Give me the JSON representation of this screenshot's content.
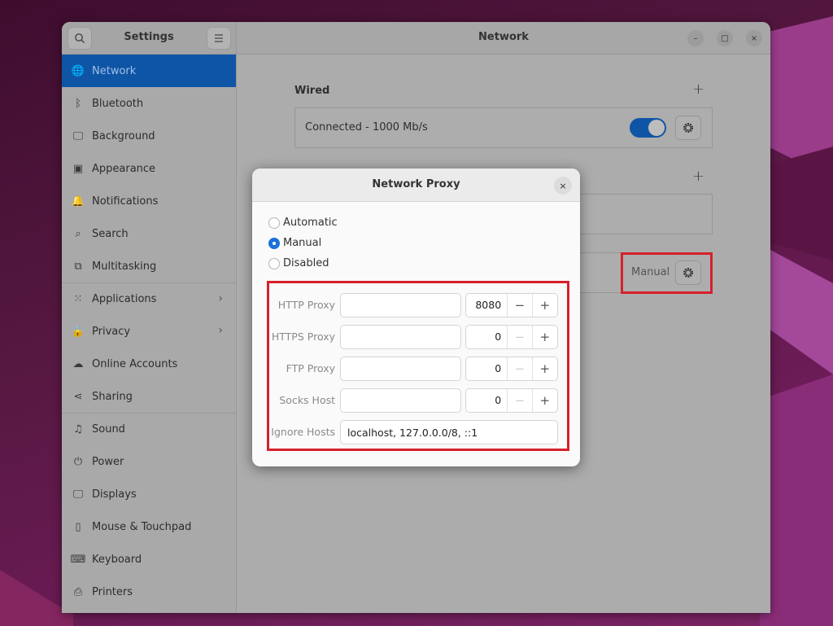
{
  "settings": {
    "title": "Settings",
    "search_icon": "search-icon",
    "menu_icon": "hamburger-menu-icon",
    "sidebar": [
      {
        "label": "Network",
        "icon": "globe-icon",
        "active": true
      },
      {
        "label": "Bluetooth",
        "icon": "bluetooth-icon"
      },
      {
        "label": "Background",
        "icon": "monitor-icon"
      },
      {
        "label": "Appearance",
        "icon": "appearance-icon"
      },
      {
        "label": "Notifications",
        "icon": "bell-icon"
      },
      {
        "label": "Search",
        "icon": "search-icon"
      },
      {
        "label": "Multitasking",
        "icon": "multitasking-icon"
      },
      {
        "label": "Applications",
        "icon": "grid-icon",
        "chevron": true
      },
      {
        "label": "Privacy",
        "icon": "lock-icon",
        "chevron": true
      },
      {
        "label": "Online Accounts",
        "icon": "cloud-icon"
      },
      {
        "label": "Sharing",
        "icon": "share-icon"
      },
      {
        "label": "Sound",
        "icon": "music-note-icon"
      },
      {
        "label": "Power",
        "icon": "power-icon"
      },
      {
        "label": "Displays",
        "icon": "display-icon"
      },
      {
        "label": "Mouse & Touchpad",
        "icon": "mouse-icon"
      },
      {
        "label": "Keyboard",
        "icon": "keyboard-icon"
      },
      {
        "label": "Printers",
        "icon": "printer-icon"
      }
    ]
  },
  "network": {
    "title": "Network",
    "window_controls": {
      "minimize": "–",
      "maximize": "□",
      "close": "×"
    },
    "wired": {
      "label": "Wired",
      "add": "+",
      "status": "Connected - 1000 Mb/s",
      "enabled": true
    },
    "vpn_add": "+",
    "proxy": {
      "status": "Manual"
    }
  },
  "proxy_dialog": {
    "title": "Network Proxy",
    "close": "×",
    "modes": [
      {
        "label": "Automatic",
        "checked": false
      },
      {
        "label": "Manual",
        "checked": true
      },
      {
        "label": "Disabled",
        "checked": false
      }
    ],
    "fields": [
      {
        "label": "HTTP Proxy",
        "host": "",
        "port": "8080",
        "minus_enabled": true
      },
      {
        "label": "HTTPS Proxy",
        "host": "",
        "port": "0",
        "minus_enabled": false
      },
      {
        "label": "FTP Proxy",
        "host": "",
        "port": "0",
        "minus_enabled": false
      },
      {
        "label": "Socks Host",
        "host": "",
        "port": "0",
        "minus_enabled": false
      }
    ],
    "ignore_hosts": {
      "label": "Ignore Hosts",
      "value": "localhost, 127.0.0.0/8, ::1"
    },
    "minus": "−",
    "plus": "+"
  },
  "colors": {
    "accent": "#0f55a6",
    "radio_checked": "#1c71d8",
    "highlight": "#d6202c"
  }
}
